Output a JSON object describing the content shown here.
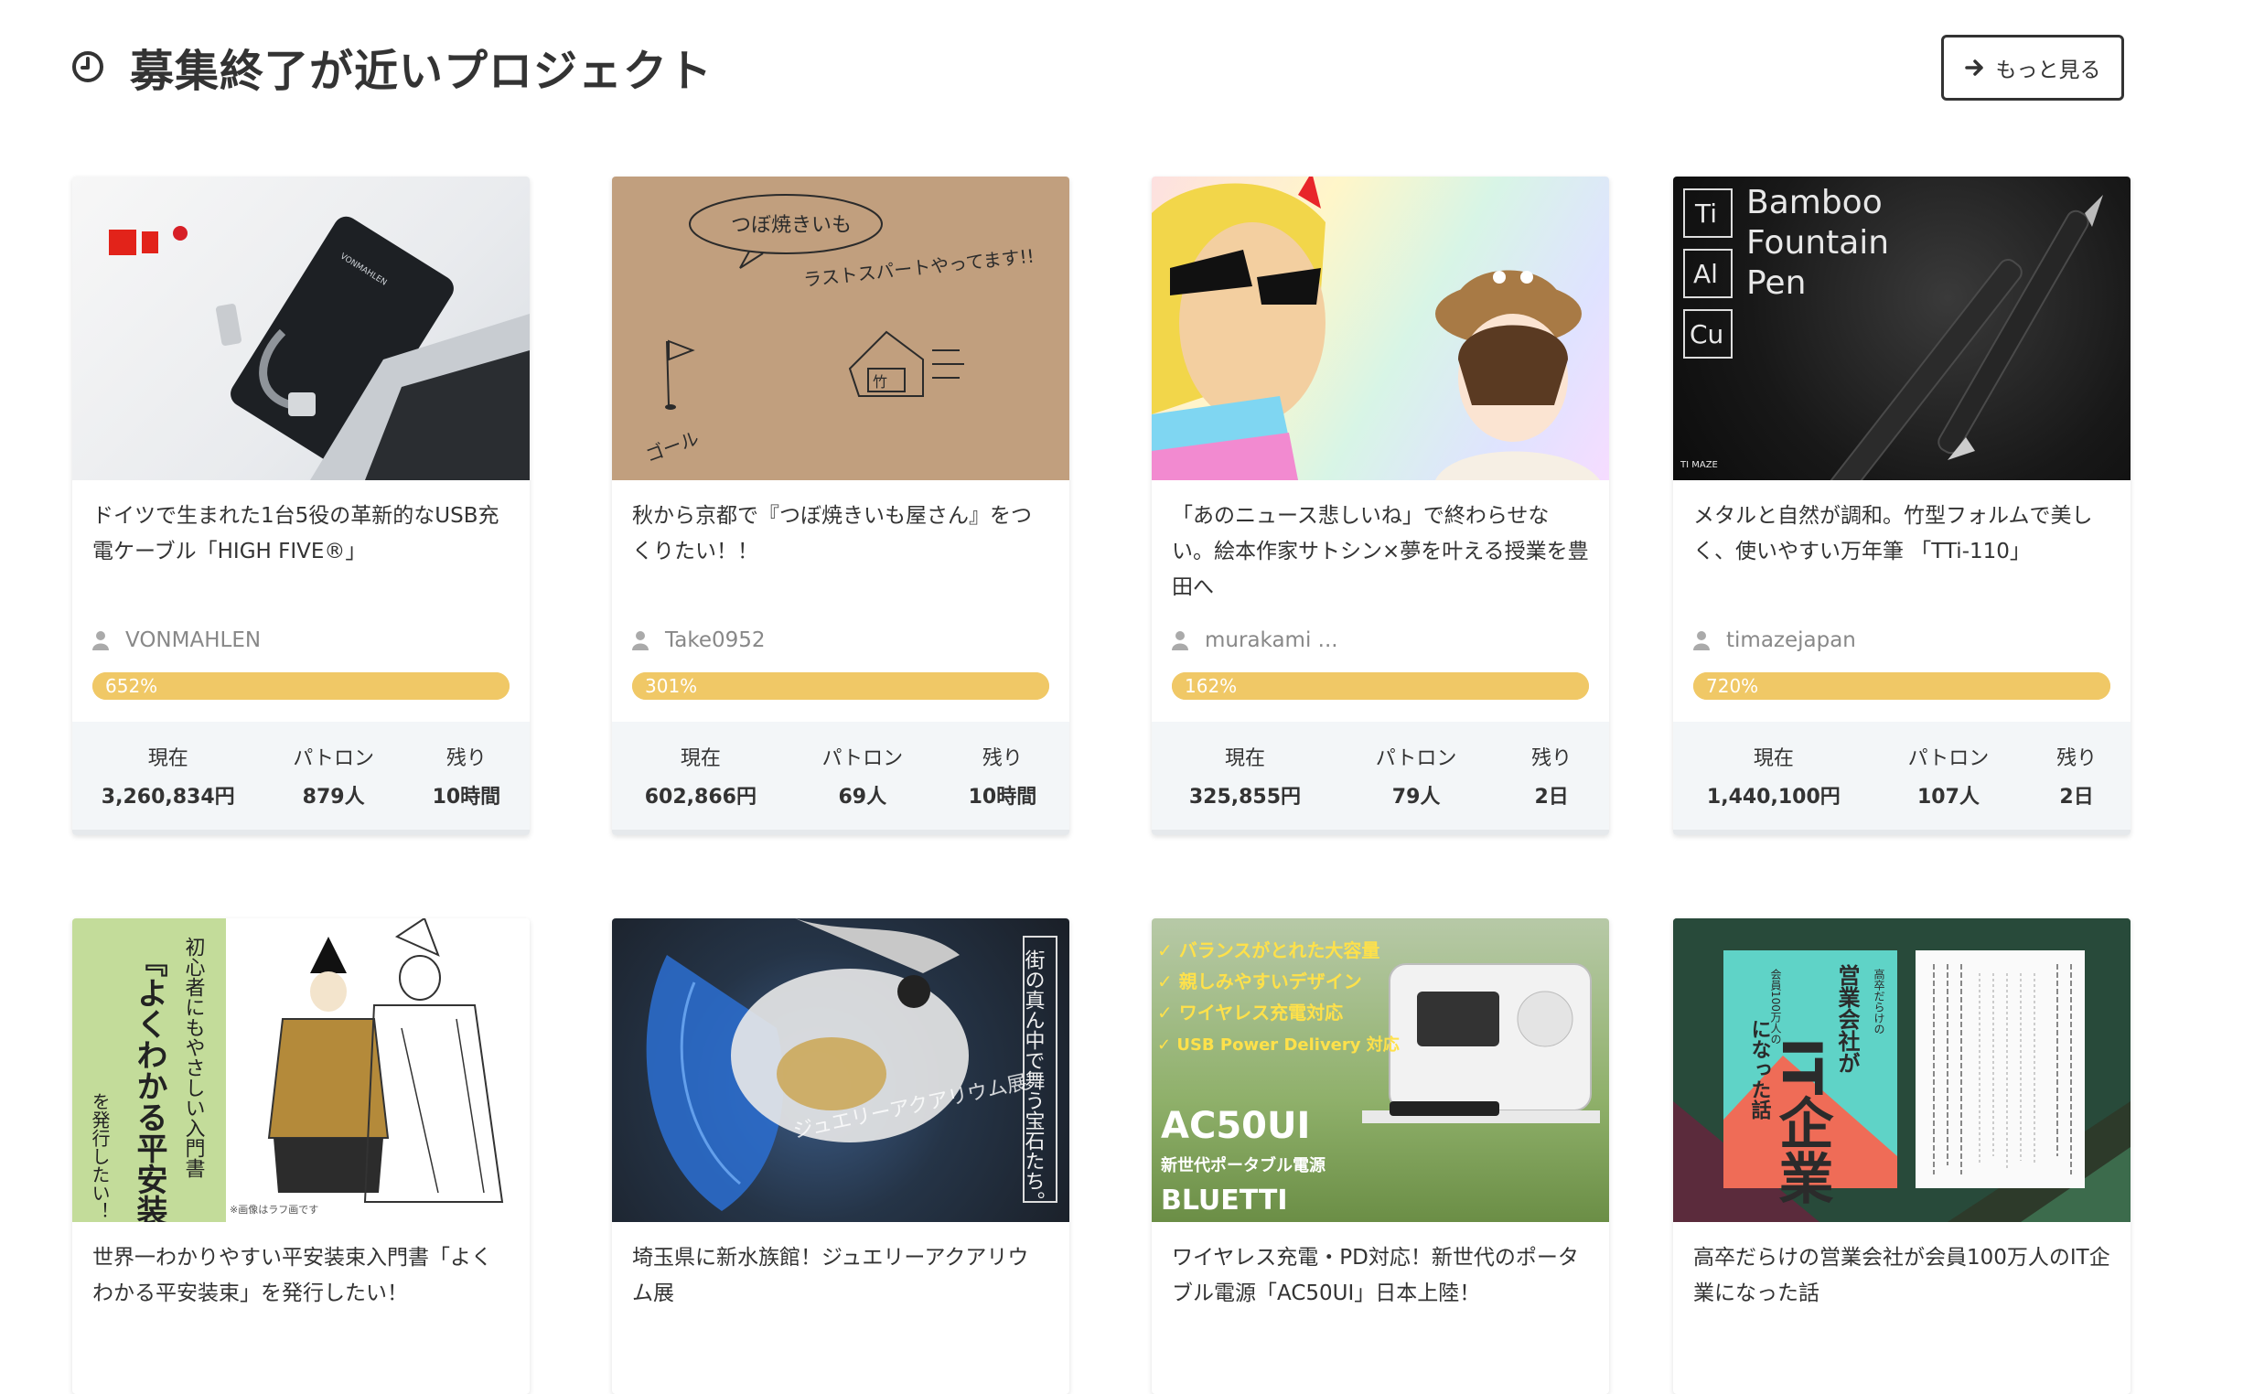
{
  "section": {
    "title": "募集終了が近いプロジェクト",
    "icon": "clock-icon",
    "more_label": "もっと見る"
  },
  "labels": {
    "current": "現在",
    "patrons": "パトロン",
    "remaining": "残り"
  },
  "colors": {
    "progress": "#f0c866",
    "stats_bg": "#f3f6f8"
  },
  "cards": [
    {
      "title": "ドイツで生まれた1台5役の革新的なUSB充電ケーブル「HIGH FIVE®」",
      "owner": "VONMAHLEN",
      "percent_label": "652%",
      "percent": 652,
      "current": "3,260,834円",
      "patrons": "879人",
      "remaining": "10時間",
      "image_text": [
        "VONMAHLEN"
      ]
    },
    {
      "title": "秋から京都で『つぼ焼きいも屋さん』をつくりたい！！",
      "owner": "Take0952",
      "percent_label": "301%",
      "percent": 301,
      "current": "602,866円",
      "patrons": "69人",
      "remaining": "10時間",
      "image_text": [
        "つぼ焼きいも",
        "ラストスパートやってます!!",
        "ゴール",
        "竹"
      ]
    },
    {
      "title": "「あのニュース悲しいね」で終わらせない。絵本作家サトシン×夢を叶える授業を豊田へ",
      "owner": "murakami ...",
      "percent_label": "162%",
      "percent": 162,
      "current": "325,855円",
      "patrons": "79人",
      "remaining": "2日"
    },
    {
      "title": "メタルと自然が調和。竹型フォルムで美しく、使いやすい万年筆 「TTi-110」",
      "owner": "timazejapan",
      "percent_label": "720%",
      "percent": 720,
      "current": "1,440,100円",
      "patrons": "107人",
      "remaining": "2日",
      "image_text": [
        "Bamboo",
        "Fountain",
        "Pen",
        "Ti",
        "Al",
        "Cu",
        "TI MAZE"
      ]
    },
    {
      "title": "世界一わかりやすい平安装束入門書「よくわかる平安装束」を発行したい！",
      "image_text": [
        "初心者にもやさしい入門書",
        "『よくわかる平安装束』",
        "を発行したい！",
        "※画像はラフ画です"
      ]
    },
    {
      "title": "埼玉県に新水族館！ジュエリーアクアリウム展",
      "image_text": [
        "街の真ん中で舞う宝石たち。",
        "ジュエリーアクアリウム展"
      ]
    },
    {
      "title": "ワイヤレス充電・PD対応！新世代のポータブル電源「AC50UI」日本上陸！",
      "image_text": [
        "✓ バランスがとれた大容量",
        "✓ 親しみやすいデザイン",
        "✓ ワイヤレス充電対応",
        "✓ USB Power Delivery 対応",
        "AC50UI",
        "新世代ポータブル電源",
        "BLUETTI"
      ]
    },
    {
      "title": "高卒だらけの営業会社が会員100万人のIT企業になった話",
      "image_text": [
        "IT企業",
        "営業会社が",
        "高卒だらけの",
        "会員100万人の",
        "になった話"
      ]
    }
  ]
}
